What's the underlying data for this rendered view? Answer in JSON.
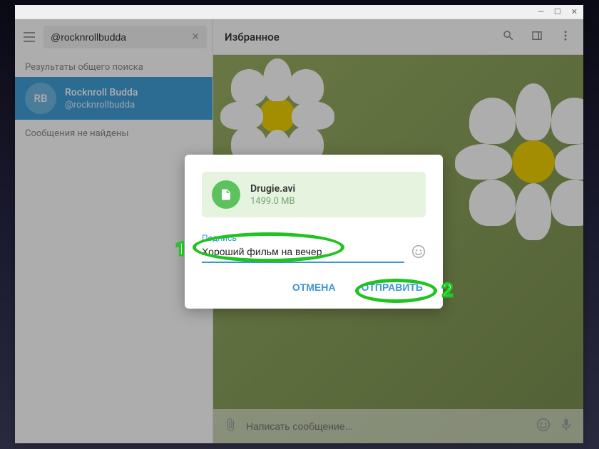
{
  "search": {
    "value": "@rocknrollbudda",
    "section_label": "Результаты общего поиска",
    "no_messages": "Сообщения не найдены"
  },
  "contact": {
    "avatar_initials": "RB",
    "name": "Rocknroll Budda",
    "handle": "@rocknrollbudda"
  },
  "chat": {
    "title": "Избранное",
    "compose_placeholder": "Написать сообщение..."
  },
  "modal": {
    "file_name": "Drugie.avi",
    "file_size": "1499.0 MB",
    "caption_label": "Подпись",
    "caption_value": "Хороший фильм на вечер",
    "cancel": "ОТМЕНА",
    "send": "ОТПРАВИТЬ"
  },
  "annotations": {
    "one": "1",
    "two": "2"
  }
}
